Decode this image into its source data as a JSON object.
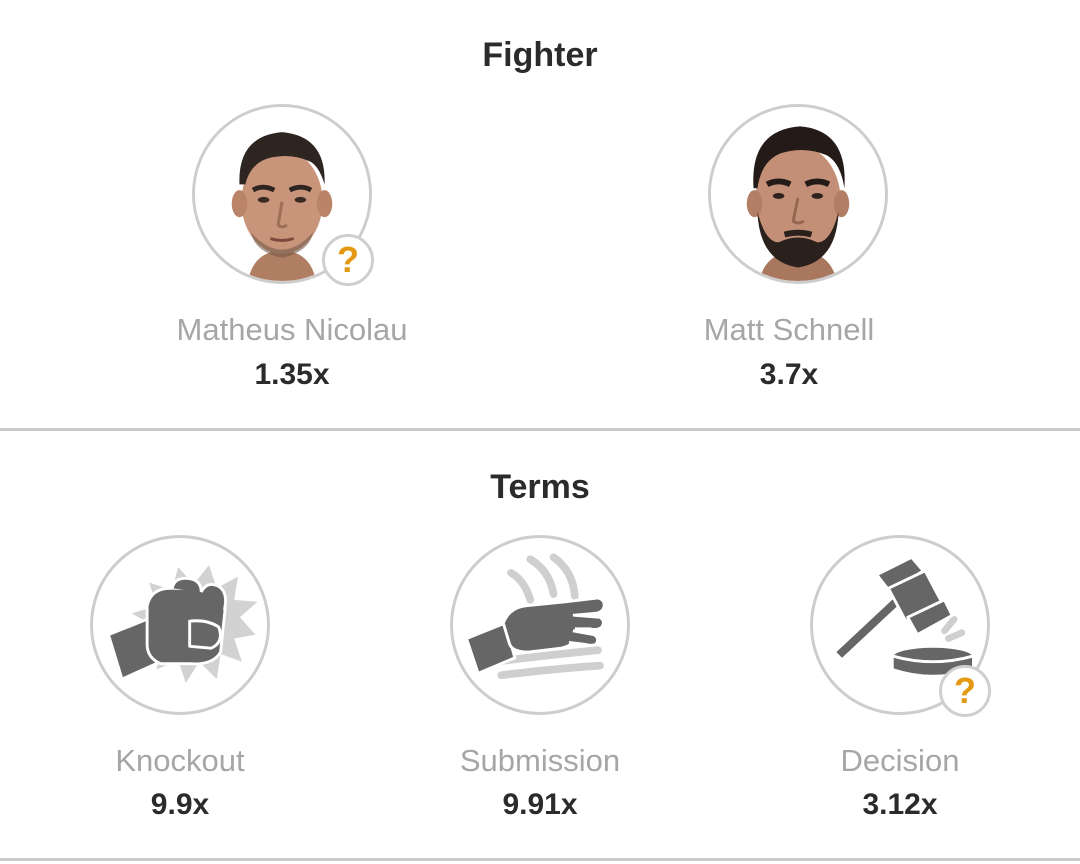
{
  "fighter_section": {
    "title": "Fighter",
    "fighters": [
      {
        "name": "Matheus Nicolau",
        "odds": "1.35x",
        "icon": "fighter-portrait",
        "badge": "?"
      },
      {
        "name": "Matt Schnell",
        "odds": "3.7x",
        "icon": "fighter-portrait"
      }
    ]
  },
  "terms_section": {
    "title": "Terms",
    "terms": [
      {
        "name": "Knockout",
        "odds": "9.9x",
        "icon": "fist-punch-icon"
      },
      {
        "name": "Submission",
        "odds": "9.91x",
        "icon": "tap-out-hand-icon"
      },
      {
        "name": "Decision",
        "odds": "3.12x",
        "icon": "gavel-icon",
        "badge": "?"
      }
    ]
  },
  "colors": {
    "badge_question": "#e39a12",
    "label_grey": "#a6a6a6",
    "odds_dark": "#2b2b2b",
    "icon_grey": "#666666",
    "border_grey": "#cdcdcd"
  }
}
